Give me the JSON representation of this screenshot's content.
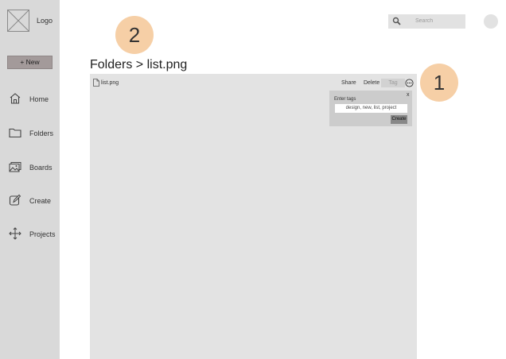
{
  "sidebar": {
    "logo_label": "Logo",
    "new_button": "+ New",
    "items": [
      {
        "label": "Home",
        "icon": "home-icon"
      },
      {
        "label": "Folders",
        "icon": "folder-icon"
      },
      {
        "label": "Boards",
        "icon": "image-icon"
      },
      {
        "label": "Create",
        "icon": "edit-icon"
      },
      {
        "label": "Projects",
        "icon": "move-icon"
      }
    ]
  },
  "header": {
    "search_placeholder": "Search",
    "callout_1": "1",
    "callout_2": "2"
  },
  "breadcrumb": "Folders > list.png",
  "panel": {
    "file_name": "list.png",
    "toolbar": {
      "share": "Share",
      "delete": "Delete",
      "tag": "Tag"
    },
    "tag_popover": {
      "close": "x",
      "label": "Enter tags",
      "value": "design, new, list, project",
      "create": "Create"
    }
  },
  "colors": {
    "sidebar": "#d9d9d9",
    "panel": "#e3e3e3",
    "callout": "#f6cfa6",
    "new_button": "#a39a9a"
  }
}
